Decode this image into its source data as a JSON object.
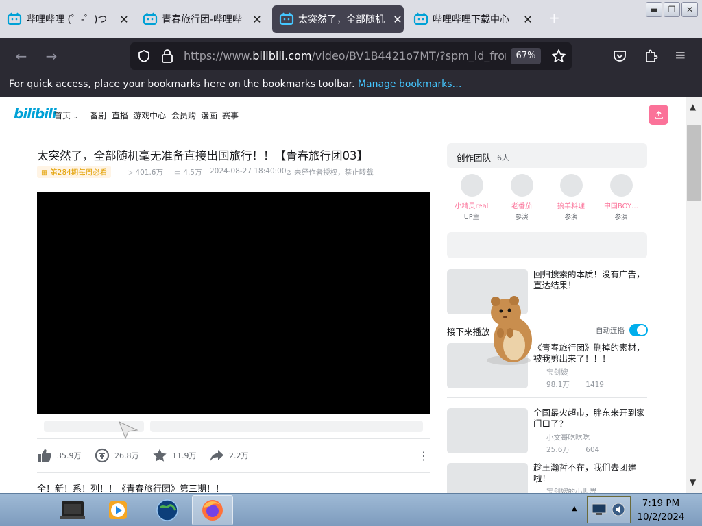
{
  "browser": {
    "tabs": [
      {
        "title": "哔哩哔哩 (゜-゜)つ",
        "active": false
      },
      {
        "title": "青春旅行团-哔哩哔",
        "active": false
      },
      {
        "title": "太突然了，全部随机",
        "active": true
      },
      {
        "title": "哔哩哔哩下载中心",
        "active": false
      }
    ],
    "url_prefix": "https://www.",
    "url_host": "bilibili.com",
    "url_path": "/video/BV1B4421o7MT/?spm_id_from",
    "zoom": "67%",
    "bookmarks_hint": "For quick access, place your bookmarks here on the bookmarks toolbar.",
    "bookmarks_link": "Manage bookmarks…"
  },
  "site": {
    "logo": "bilibili",
    "nav": [
      "首页",
      "番剧",
      "直播",
      "游戏中心",
      "会员购",
      "漫画",
      "赛事"
    ]
  },
  "video": {
    "title": "太突然了，全部随机毫无准备直接出国旅行！！【青春旅行团03】",
    "rank_badge": "第284期每周必看",
    "views": "401.6万",
    "danmaku": "4.5万",
    "date": "2024-08-27 18:40:00",
    "copyright": "未经作者授权，禁止转载",
    "likes": "35.9万",
    "coins": "26.8万",
    "favorites": "11.9万",
    "shares": "2.2万",
    "description": "全！新！系！列！！《青春旅行团》第三期！！"
  },
  "team": {
    "title": "创作团队",
    "count": "6人",
    "members": [
      {
        "name": "小精灵real",
        "role": "UP主"
      },
      {
        "name": "老番茄",
        "role": "参演"
      },
      {
        "name": "搞羊料理",
        "role": "参演"
      },
      {
        "name": "中国BOY…",
        "role": "参演"
      }
    ]
  },
  "sidebar": {
    "ad_title": "回归搜索的本质！没有广告，直达结果！",
    "up_next": "接下来播放",
    "autoplay": "自动连播",
    "recommendations": [
      {
        "title": "《青春旅行团》删掉的素材，被我剪出来了！！！",
        "author": "宝剑嫂",
        "views": "98.1万",
        "danmaku": "1419"
      },
      {
        "title": "全国最火超市，胖东来开到家门口了？",
        "author": "小文哥吃吃吃",
        "views": "25.6万",
        "danmaku": "604"
      },
      {
        "title": "趁王瀚哲不在，我们去团建啦！",
        "author": "宝剑嫂的小世界",
        "views": "",
        "danmaku": ""
      }
    ]
  },
  "taskbar": {
    "time": "7:19 PM",
    "date": "10/2/2024"
  },
  "colors": {
    "accent_blue": "#00a1d6",
    "accent_pink": "#fb7299",
    "toggle_blue": "#00aeec"
  }
}
